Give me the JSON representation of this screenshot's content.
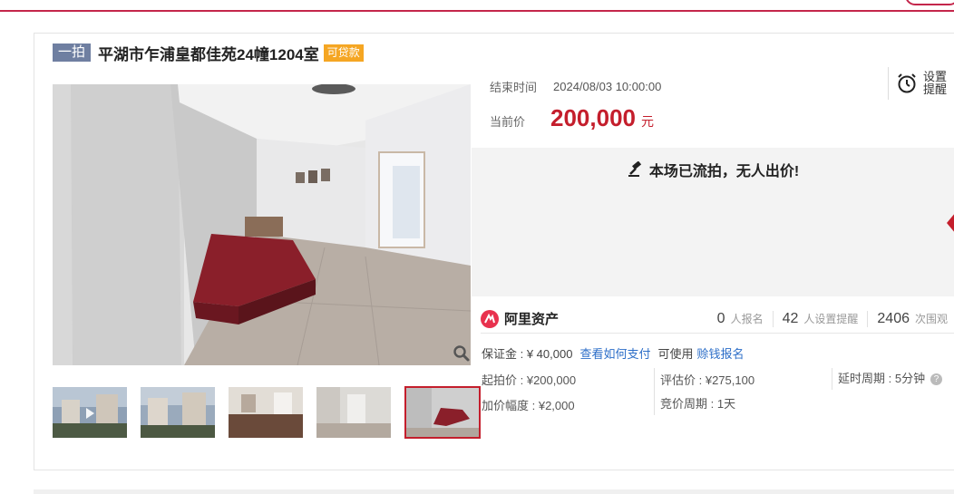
{
  "listing": {
    "round": "一拍",
    "title": "平湖市乍浦皇都佳苑24幢1204室",
    "loan_badge": "可贷款"
  },
  "auction": {
    "end_label": "结束时间",
    "end_time": "2024/08/03 10:00:00",
    "price_label": "当前价",
    "price": "200,000",
    "price_unit": "元",
    "remind_label": "设置提醒",
    "status": "本场已流拍，无人出价!"
  },
  "brand": {
    "name": "阿里资产"
  },
  "stats": [
    {
      "num": "0",
      "unit": "人报名"
    },
    {
      "num": "42",
      "unit": "人设置提醒"
    },
    {
      "num": "2406",
      "unit": "次围观"
    }
  ],
  "deposit": {
    "label": "保证金 : ¥ 40,000",
    "how_to_pay": "查看如何支付",
    "usable": "可使用",
    "earn_signup": "赊钱报名"
  },
  "params": {
    "start_price": "起拍价 : ¥200,000",
    "increment": "加价幅度 : ¥2,000",
    "assessed": "评估价 : ¥275,100",
    "cycle": "竞价周期 : 1天",
    "delay": "延时周期 : 5分钟"
  },
  "icons": {
    "zoom": "zoom-icon",
    "alarm": "alarm-clock-icon",
    "gavel": "gavel-icon",
    "help": "help-icon"
  },
  "colors": {
    "accent": "#c41e2c",
    "brand": "#e8314e",
    "link": "#2c6ec8",
    "round_badge": "#6f7fa1",
    "loan_badge": "#f5a623"
  }
}
